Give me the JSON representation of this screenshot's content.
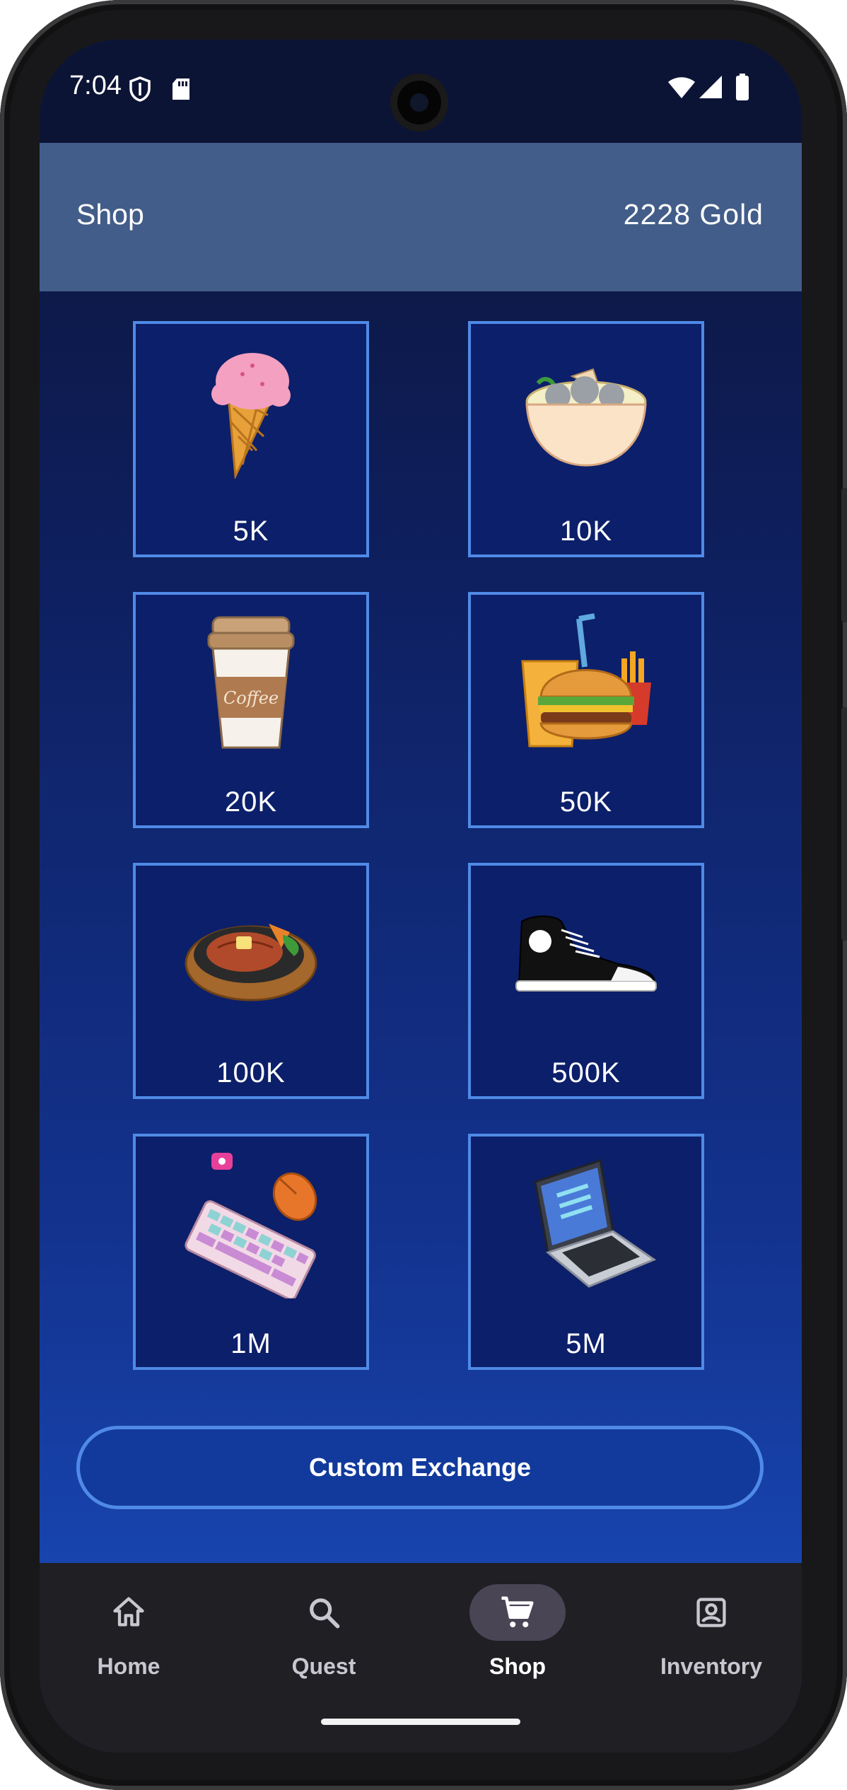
{
  "status_bar": {
    "time": "7:04"
  },
  "app_bar": {
    "title": "Shop",
    "gold": "2228 Gold"
  },
  "shop_items": [
    {
      "price": "5K",
      "icon": "ice-cream-icon"
    },
    {
      "price": "10K",
      "icon": "meatball-soup-icon"
    },
    {
      "price": "20K",
      "icon": "coffee-cup-icon"
    },
    {
      "price": "50K",
      "icon": "burger-meal-icon"
    },
    {
      "price": "100K",
      "icon": "steak-icon"
    },
    {
      "price": "500K",
      "icon": "sneaker-icon"
    },
    {
      "price": "1M",
      "icon": "keyboard-mouse-icon"
    },
    {
      "price": "5M",
      "icon": "laptop-icon"
    }
  ],
  "custom_button": "Custom Exchange",
  "nav": [
    {
      "label": "Home",
      "icon": "home-icon"
    },
    {
      "label": "Quest",
      "icon": "search-icon"
    },
    {
      "label": "Shop",
      "icon": "cart-icon",
      "active": true
    },
    {
      "label": "Inventory",
      "icon": "portrait-icon"
    }
  ],
  "colors": {
    "accent_border": "#4f8ae6",
    "app_bar": "#435d8a",
    "nav_bg": "#1f1f24"
  }
}
